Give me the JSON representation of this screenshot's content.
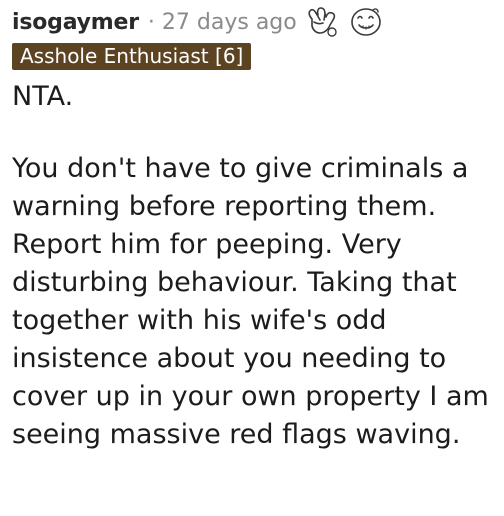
{
  "comment": {
    "author": "isogaymer",
    "separator": "·",
    "timestamp": "27 days ago",
    "awards": [
      {
        "icon": "hand-wave-award-icon"
      },
      {
        "icon": "face-award-icon"
      }
    ],
    "flair": {
      "text": "Asshole Enthusiast [6]",
      "background": "#5c4321",
      "color": "#ffffff"
    },
    "paragraphs": [
      "NTA.",
      "You don't have to give criminals a warning before reporting them. Report him for peeping. Very disturbing behaviour. Taking that together with his wife's odd insistence about you needing to cover up in your own property I am seeing massive red flags waving."
    ]
  }
}
